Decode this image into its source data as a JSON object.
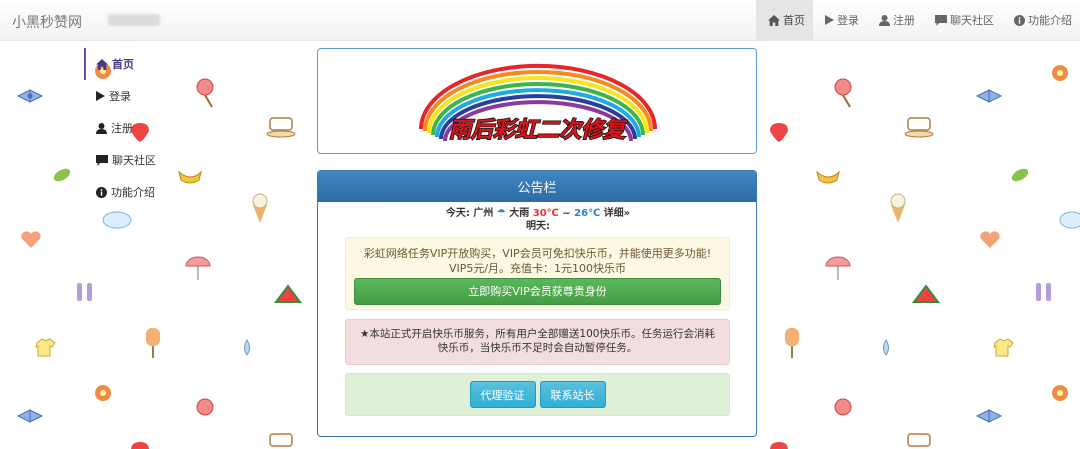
{
  "app": {
    "brand": "小黑秒赞网"
  },
  "nav": {
    "items": [
      {
        "label": "首页",
        "icon": "home-icon",
        "active": true
      },
      {
        "label": "登录",
        "icon": "play-icon",
        "active": false
      },
      {
        "label": "注册",
        "icon": "user-icon",
        "active": false
      },
      {
        "label": "聊天社区",
        "icon": "comment-icon",
        "active": false
      },
      {
        "label": "功能介绍",
        "icon": "info-circle-icon",
        "active": false
      }
    ]
  },
  "sidebar": {
    "items": [
      {
        "label": "首页",
        "icon": "home-icon",
        "active": true
      },
      {
        "label": "登录",
        "icon": "play-icon",
        "active": false
      },
      {
        "label": "注册",
        "icon": "user-icon",
        "active": false
      },
      {
        "label": "聊天社区",
        "icon": "comment-icon",
        "active": false
      },
      {
        "label": "功能介绍",
        "icon": "info-circle-icon",
        "active": false
      }
    ]
  },
  "banner": {
    "text": "雨后彩虹二次修复"
  },
  "panel": {
    "title": "公告栏",
    "weather": {
      "line1_label": "今天:",
      "line1_city": "广州",
      "line1_condition": "大雨",
      "line1_high": "30℃",
      "line1_sep": "~",
      "line1_low": "26℃",
      "line1_detail": "详细»",
      "line2_label": "明天:"
    },
    "vip_notice": {
      "line1": "彩虹网络任务VIP开放购买，VIP会员可免扣快乐币，并能使用更多功能!",
      "line2": "VIP5元/月。充值卡：1元100快乐币",
      "button": "立即购买VIP会员获尊贵身份"
    },
    "red_notice": "★本站正式开启快乐币服务，所有用户全部赠送100快乐币。任务运行会消耗快乐币，当快乐币不足时会自动暂停任务。",
    "actions": {
      "agent_verify": "代理验证",
      "contact": "联系站长"
    }
  },
  "colors": {
    "panel_header": "#337ab7",
    "vip_button": "#5cb85c",
    "info_button": "#5bc0de",
    "notice_yellow": "#fcf8e3",
    "notice_red": "#f2dede",
    "notice_green": "#dff0d8",
    "sidebar_accent": "#6a4bb0"
  }
}
